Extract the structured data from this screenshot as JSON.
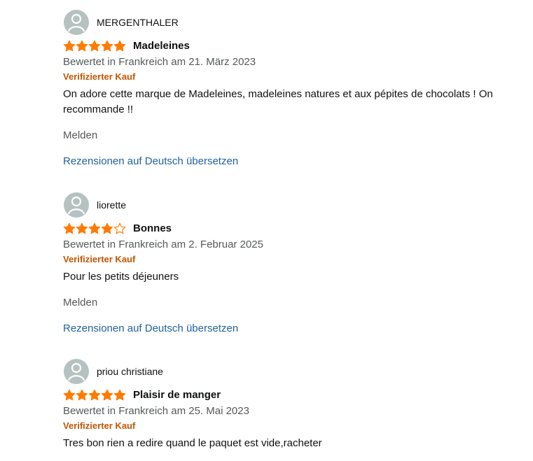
{
  "colors": {
    "star_fill": "#ff7a00",
    "verified": "#c45500",
    "link": "#2162a1",
    "secondary_text": "#565959",
    "avatar_bg": "#b6c1c1"
  },
  "reviews": [
    {
      "author": "MERGENTHALER",
      "rating": 5,
      "rating_max": 5,
      "title": "Madeleines",
      "date": "Bewertet in Frankreich am 21. März 2023",
      "verified": "Verifizierter Kauf",
      "text": "On adore cette marque de Madeleines, madeleines natures et aux pépites de chocolats ! On recommande !!",
      "report_label": "Melden",
      "translate_label": "Rezensionen auf Deutsch übersetzen"
    },
    {
      "author": "liorette",
      "rating": 4,
      "rating_max": 5,
      "title": "Bonnes",
      "date": "Bewertet in Frankreich am 2. Februar 2025",
      "verified": "Verifizierter Kauf",
      "text": "Pour les petits déjeuners",
      "report_label": "Melden",
      "translate_label": "Rezensionen auf Deutsch übersetzen"
    },
    {
      "author": "priou christiane",
      "rating": 5,
      "rating_max": 5,
      "title": "Plaisir de manger",
      "date": "Bewertet in Frankreich am 25. Mai 2023",
      "verified": "Verifizierter Kauf",
      "text": "Tres bon rien a redire quand le paquet est vide,racheter"
    }
  ]
}
